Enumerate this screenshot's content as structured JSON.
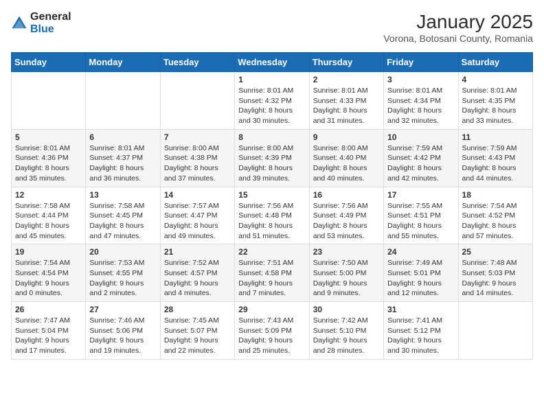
{
  "logo": {
    "general": "General",
    "blue": "Blue"
  },
  "header": {
    "month": "January 2025",
    "location": "Vorona, Botosani County, Romania"
  },
  "weekdays": [
    "Sunday",
    "Monday",
    "Tuesday",
    "Wednesday",
    "Thursday",
    "Friday",
    "Saturday"
  ],
  "weeks": [
    [
      {
        "day": "",
        "info": ""
      },
      {
        "day": "",
        "info": ""
      },
      {
        "day": "",
        "info": ""
      },
      {
        "day": "1",
        "info": "Sunrise: 8:01 AM\nSunset: 4:32 PM\nDaylight: 8 hours\nand 30 minutes."
      },
      {
        "day": "2",
        "info": "Sunrise: 8:01 AM\nSunset: 4:33 PM\nDaylight: 8 hours\nand 31 minutes."
      },
      {
        "day": "3",
        "info": "Sunrise: 8:01 AM\nSunset: 4:34 PM\nDaylight: 8 hours\nand 32 minutes."
      },
      {
        "day": "4",
        "info": "Sunrise: 8:01 AM\nSunset: 4:35 PM\nDaylight: 8 hours\nand 33 minutes."
      }
    ],
    [
      {
        "day": "5",
        "info": "Sunrise: 8:01 AM\nSunset: 4:36 PM\nDaylight: 8 hours\nand 35 minutes."
      },
      {
        "day": "6",
        "info": "Sunrise: 8:01 AM\nSunset: 4:37 PM\nDaylight: 8 hours\nand 36 minutes."
      },
      {
        "day": "7",
        "info": "Sunrise: 8:00 AM\nSunset: 4:38 PM\nDaylight: 8 hours\nand 37 minutes."
      },
      {
        "day": "8",
        "info": "Sunrise: 8:00 AM\nSunset: 4:39 PM\nDaylight: 8 hours\nand 39 minutes."
      },
      {
        "day": "9",
        "info": "Sunrise: 8:00 AM\nSunset: 4:40 PM\nDaylight: 8 hours\nand 40 minutes."
      },
      {
        "day": "10",
        "info": "Sunrise: 7:59 AM\nSunset: 4:42 PM\nDaylight: 8 hours\nand 42 minutes."
      },
      {
        "day": "11",
        "info": "Sunrise: 7:59 AM\nSunset: 4:43 PM\nDaylight: 8 hours\nand 44 minutes."
      }
    ],
    [
      {
        "day": "12",
        "info": "Sunrise: 7:58 AM\nSunset: 4:44 PM\nDaylight: 8 hours\nand 45 minutes."
      },
      {
        "day": "13",
        "info": "Sunrise: 7:58 AM\nSunset: 4:45 PM\nDaylight: 8 hours\nand 47 minutes."
      },
      {
        "day": "14",
        "info": "Sunrise: 7:57 AM\nSunset: 4:47 PM\nDaylight: 8 hours\nand 49 minutes."
      },
      {
        "day": "15",
        "info": "Sunrise: 7:56 AM\nSunset: 4:48 PM\nDaylight: 8 hours\nand 51 minutes."
      },
      {
        "day": "16",
        "info": "Sunrise: 7:56 AM\nSunset: 4:49 PM\nDaylight: 8 hours\nand 53 minutes."
      },
      {
        "day": "17",
        "info": "Sunrise: 7:55 AM\nSunset: 4:51 PM\nDaylight: 8 hours\nand 55 minutes."
      },
      {
        "day": "18",
        "info": "Sunrise: 7:54 AM\nSunset: 4:52 PM\nDaylight: 8 hours\nand 57 minutes."
      }
    ],
    [
      {
        "day": "19",
        "info": "Sunrise: 7:54 AM\nSunset: 4:54 PM\nDaylight: 9 hours\nand 0 minutes."
      },
      {
        "day": "20",
        "info": "Sunrise: 7:53 AM\nSunset: 4:55 PM\nDaylight: 9 hours\nand 2 minutes."
      },
      {
        "day": "21",
        "info": "Sunrise: 7:52 AM\nSunset: 4:57 PM\nDaylight: 9 hours\nand 4 minutes."
      },
      {
        "day": "22",
        "info": "Sunrise: 7:51 AM\nSunset: 4:58 PM\nDaylight: 9 hours\nand 7 minutes."
      },
      {
        "day": "23",
        "info": "Sunrise: 7:50 AM\nSunset: 5:00 PM\nDaylight: 9 hours\nand 9 minutes."
      },
      {
        "day": "24",
        "info": "Sunrise: 7:49 AM\nSunset: 5:01 PM\nDaylight: 9 hours\nand 12 minutes."
      },
      {
        "day": "25",
        "info": "Sunrise: 7:48 AM\nSunset: 5:03 PM\nDaylight: 9 hours\nand 14 minutes."
      }
    ],
    [
      {
        "day": "26",
        "info": "Sunrise: 7:47 AM\nSunset: 5:04 PM\nDaylight: 9 hours\nand 17 minutes."
      },
      {
        "day": "27",
        "info": "Sunrise: 7:46 AM\nSunset: 5:06 PM\nDaylight: 9 hours\nand 19 minutes."
      },
      {
        "day": "28",
        "info": "Sunrise: 7:45 AM\nSunset: 5:07 PM\nDaylight: 9 hours\nand 22 minutes."
      },
      {
        "day": "29",
        "info": "Sunrise: 7:43 AM\nSunset: 5:09 PM\nDaylight: 9 hours\nand 25 minutes."
      },
      {
        "day": "30",
        "info": "Sunrise: 7:42 AM\nSunset: 5:10 PM\nDaylight: 9 hours\nand 28 minutes."
      },
      {
        "day": "31",
        "info": "Sunrise: 7:41 AM\nSunset: 5:12 PM\nDaylight: 9 hours\nand 30 minutes."
      },
      {
        "day": "",
        "info": ""
      }
    ]
  ]
}
